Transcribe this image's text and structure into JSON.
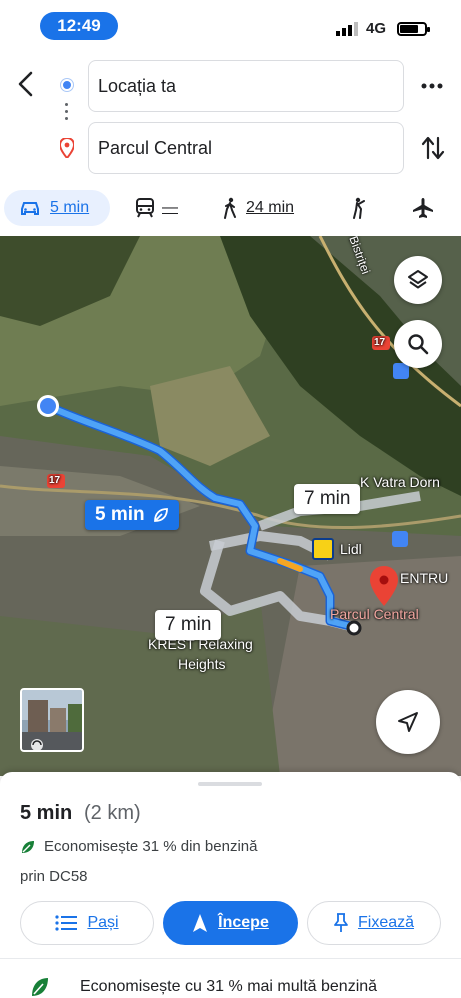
{
  "status_bar": {
    "time": "12:49",
    "network": "4G"
  },
  "search": {
    "origin": "Locația ta",
    "destination": "Parcul Central"
  },
  "modes": {
    "car": "5 min",
    "transit": "—",
    "walk": "24 min"
  },
  "map": {
    "labels": {
      "bistritei": "Bistriței",
      "vatra": "K  Vatra Dorn",
      "lidl": "Lidl",
      "centru": "ENTRU",
      "parcul": "Parcul Central",
      "krest": "KREST Relaxing",
      "heights": "Heights",
      "road_a": "17",
      "road_b": "17"
    },
    "bubbles": {
      "main": "5 min",
      "alt1": "7 min",
      "alt2": "7 min"
    },
    "colors": {
      "route": "#4fa3f7",
      "alt_route": "#c8ccd2",
      "pin": "#ea4335"
    }
  },
  "sheet": {
    "time": "5 min",
    "distance": "(2 km)",
    "eco": "Economisește 31 % din benzină",
    "via": "prin DC58",
    "buttons": {
      "steps": "Pași",
      "start": "Începe",
      "pin": "Fixează"
    },
    "eco_footer": "Economisește cu 31 % mai multă benzină"
  }
}
